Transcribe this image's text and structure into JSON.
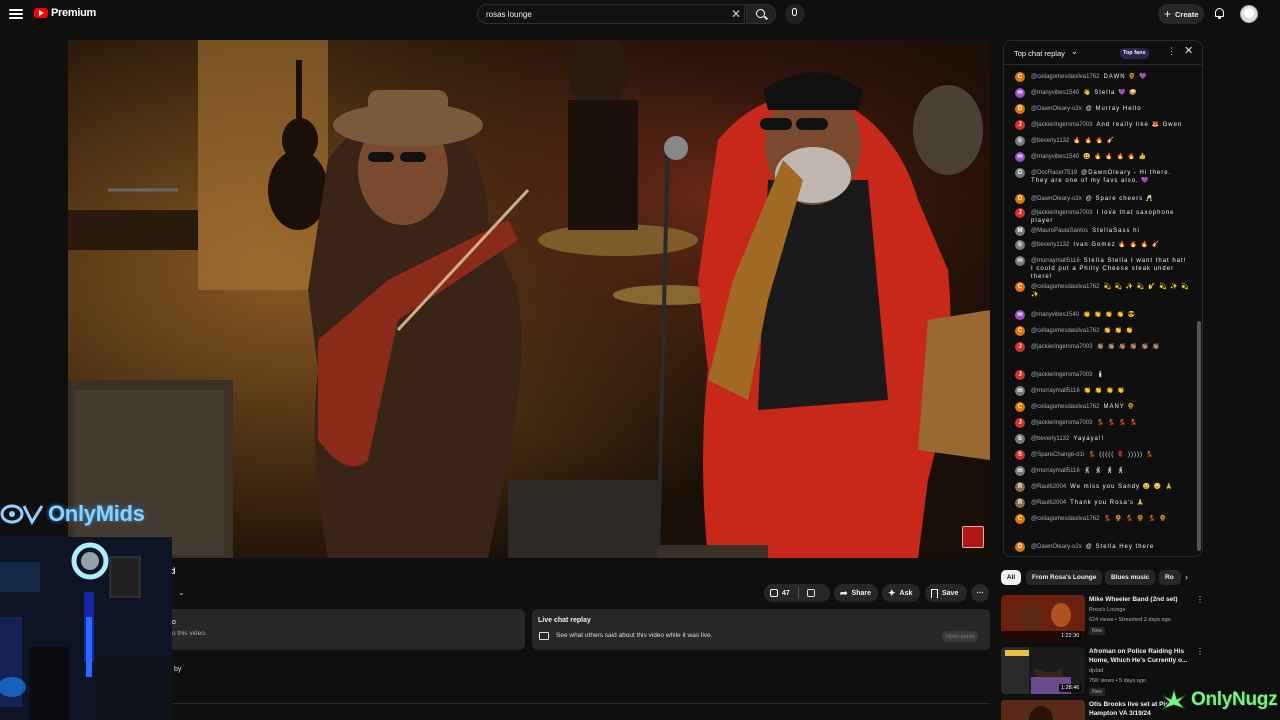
{
  "header": {
    "logo_text": "Premium",
    "search_value": "rosas lounge",
    "create_label": "Create"
  },
  "video": {
    "title_fragment": "d",
    "like_count": "47",
    "share_label": "Share",
    "ask_label": "Ask",
    "save_label": "Save",
    "desc_line1": "o",
    "desc_line2": "o this video.",
    "by_text": "by",
    "live_replay_title": "Live chat replay",
    "live_replay_text": "See what others said about this video while it was live.",
    "open_panel_label": "Open panel"
  },
  "chat": {
    "header_title": "Top chat replay",
    "top_fans_label": "Top fans",
    "messages": [
      {
        "user": "@celiagomesdasilva1762",
        "text": "DAWN 🌻 💜",
        "initial": "C",
        "color": "#e8710a"
      },
      {
        "user": "@manyvibes1540",
        "text": "👋 Stella 💜 🥪",
        "initial": "m",
        "color": "#9c4dc4"
      },
      {
        "user": "@DawnOleary-o2x",
        "text": "@ Murray Hello",
        "initial": "D",
        "color": "#e8710a"
      },
      {
        "user": "@jackieringersma7003",
        "text": "And really like 🦊 Gwen",
        "initial": "J",
        "color": "#d93025"
      },
      {
        "user": "@beverly1132",
        "text": "🔥 🔥 🔥 🎸",
        "initial": "b",
        "color": "#7a7a7a"
      },
      {
        "user": "@manyvibes1540",
        "text": "😃 🔥 🔥 🔥 🔥 👍",
        "initial": "m",
        "color": "#9c4dc4"
      },
      {
        "user": "@DocRacer7519",
        "text": "@DawnOleary - Hi there. They are one of my favs also. 💜",
        "initial": "D",
        "color": "#7a7a7a"
      },
      {
        "user": "@DawnOleary-o2x",
        "text": "@ Spare cheers 🥂",
        "initial": "D",
        "color": "#e8710a"
      },
      {
        "user": "@jackieringersma7003",
        "text": "I love that saxophone player",
        "initial": "J",
        "color": "#d93025"
      },
      {
        "user": "@MauroPaulaSantos",
        "text": "StellaSass hi",
        "initial": "M",
        "color": "#7a7a7a"
      },
      {
        "user": "@beverly1132",
        "text": "Ivan Gomez 🔥 🔥 🔥 🎸",
        "initial": "b",
        "color": "#7a7a7a"
      },
      {
        "user": "@murraymall5116",
        "text": "Stella Stella I want that hat! I could put a Philly Cheese steak under there!",
        "initial": "m",
        "color": "#7a7a7a"
      },
      {
        "user": "@celiagomesdasilva1762",
        "text": "💫 💫 ✨ 💫 🎷 💫 ✨ 💫 ✨",
        "initial": "C",
        "color": "#e8710a"
      },
      {
        "user": "@manyvibes1540",
        "text": "👏 👏 👏 👏 😎",
        "initial": "m",
        "color": "#9c4dc4"
      },
      {
        "user": "@celiagomesdasilva1762",
        "text": "👏 👏 👏",
        "initial": "C",
        "color": "#e8710a"
      },
      {
        "user": "@jackieringersma7003",
        "text": "👏🏽 👏🏽 👏🏽 👏🏽 👏🏽 👏🏽",
        "initial": "J",
        "color": "#d93025"
      },
      {
        "user": "@jackieringersma7003",
        "text": "🕯️",
        "initial": "J",
        "color": "#d93025"
      },
      {
        "user": "@murraymall5116",
        "text": "👏 👏 👏 👏",
        "initial": "m",
        "color": "#7a7a7a"
      },
      {
        "user": "@celiagomesdasilva1762",
        "text": "MANY 🌻",
        "initial": "C",
        "color": "#e8710a"
      },
      {
        "user": "@jackieringersma7003",
        "text": "💃 💃 💃 💃",
        "initial": "J",
        "color": "#d93025"
      },
      {
        "user": "@beverly1132",
        "text": "Yayaya!!",
        "initial": "b",
        "color": "#7a7a7a"
      },
      {
        "user": "@SpareChange-d1i",
        "text": "💃 ((((( 🌹 ))))) 💃",
        "initial": "S",
        "color": "#d93025"
      },
      {
        "user": "@murraymall5116",
        "text": "🕺 🕺 🕺 🕺",
        "initial": "m",
        "color": "#7a7a7a"
      },
      {
        "user": "@Raul62004",
        "text": "We miss you Sandy 😢 😔 🙏",
        "initial": "R",
        "color": "#8a6a4a"
      },
      {
        "user": "@Raul62004",
        "text": "Thank you Rosa's 🙏",
        "initial": "R",
        "color": "#8a6a4a"
      },
      {
        "user": "@celiagomesdasilva1762",
        "text": "💃 🌻 💃 🌻 💃 🌻",
        "initial": "C",
        "color": "#e8710a"
      },
      {
        "user": "@DawnOleary-o2x",
        "text": "@ Stella Hey there",
        "initial": "D",
        "color": "#e8710a"
      }
    ]
  },
  "chips": [
    "All",
    "From Rosa's Lounge",
    "Blues music",
    "Ro"
  ],
  "recommendations": [
    {
      "title": "Mike Wheeler Band (2nd set)",
      "channel": "Rosa's Lounge",
      "meta": "624 views • Streamed 2 days ago",
      "badge": "New",
      "duration": "1:22:30"
    },
    {
      "title": "Afroman on Police Raiding His Home, Which He's Currently o...",
      "channel": "djvlad",
      "meta": "75K views • 5 days ago",
      "badge": "New",
      "duration": "1:28:46"
    },
    {
      "title": "Otis Brooks live set at Pink Hampton VA 3/19/24",
      "channel": "",
      "meta": "",
      "badge": "",
      "duration": ""
    }
  ],
  "overlays": {
    "streamer_logo": "OnlyMids",
    "watermark": "OnlyNugz"
  },
  "colors": {
    "background": "#0f0f0f",
    "surface": "#272727",
    "brand_red": "#ff0000"
  }
}
